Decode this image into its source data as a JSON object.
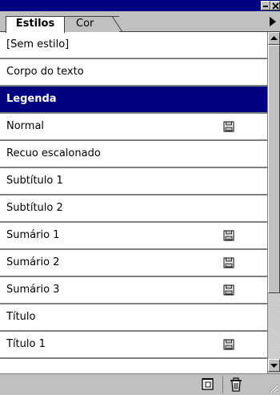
{
  "tabs": [
    {
      "label": "Estilos",
      "active": true
    },
    {
      "label": "Cor",
      "active": false
    }
  ],
  "styles": [
    {
      "label": "[Sem estilo]",
      "selected": false,
      "saved": false
    },
    {
      "label": "Corpo do texto",
      "selected": false,
      "saved": false
    },
    {
      "label": "Legenda",
      "selected": true,
      "saved": false
    },
    {
      "label": "Normal",
      "selected": false,
      "saved": true
    },
    {
      "label": "Recuo escalonado",
      "selected": false,
      "saved": false
    },
    {
      "label": "Subtítulo 1",
      "selected": false,
      "saved": false
    },
    {
      "label": "Subtítulo 2",
      "selected": false,
      "saved": false
    },
    {
      "label": "Sumário 1",
      "selected": false,
      "saved": true
    },
    {
      "label": "Sumário 2",
      "selected": false,
      "saved": true
    },
    {
      "label": "Sumário 3",
      "selected": false,
      "saved": true
    },
    {
      "label": "Título",
      "selected": false,
      "saved": false
    },
    {
      "label": "Título 1",
      "selected": false,
      "saved": true
    }
  ],
  "icons": {
    "row_saved": "disk-icon",
    "new_style": "new-style-icon",
    "delete_style": "trash-icon",
    "palette_menu": "triangle-right-icon"
  },
  "colors": {
    "titlebar": "#000080",
    "selection": "#000080",
    "chrome": "#c0c0c0"
  }
}
